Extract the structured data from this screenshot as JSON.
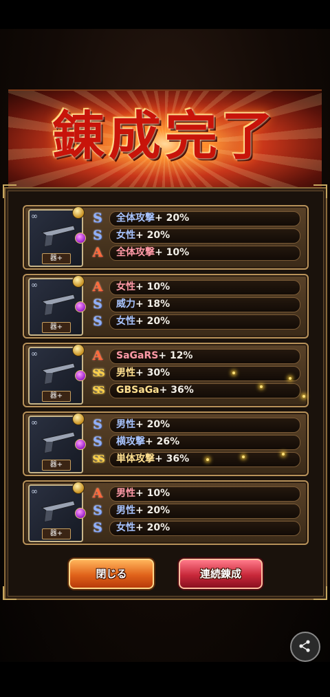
{
  "title": "錬成完了",
  "weapon_tag": "器+",
  "cards": [
    {
      "rows": [
        {
          "rank": "S",
          "name": "全体攻撃",
          "value": "+ 20%"
        },
        {
          "rank": "S",
          "name": "女性",
          "value": "+ 20%"
        },
        {
          "rank": "A",
          "name": "全体攻撃",
          "value": "+ 10%"
        }
      ]
    },
    {
      "rows": [
        {
          "rank": "A",
          "name": "女性",
          "value": "+ 10%"
        },
        {
          "rank": "S",
          "name": "威力",
          "value": "+ 18%"
        },
        {
          "rank": "S",
          "name": "女性",
          "value": "+ 20%"
        }
      ]
    },
    {
      "rows": [
        {
          "rank": "A",
          "name": "SaGaRS",
          "value": "+ 12%"
        },
        {
          "rank": "SS",
          "name": "男性",
          "value": "+ 30%"
        },
        {
          "rank": "SS",
          "name": "GBSaGa",
          "value": "+ 36%"
        }
      ]
    },
    {
      "rows": [
        {
          "rank": "S",
          "name": "男性",
          "value": "+ 20%"
        },
        {
          "rank": "S",
          "name": "横攻撃",
          "value": "+ 26%"
        },
        {
          "rank": "SS",
          "name": "単体攻撃",
          "value": "+ 36%"
        }
      ]
    },
    {
      "rows": [
        {
          "rank": "A",
          "name": "男性",
          "value": "+ 10%"
        },
        {
          "rank": "S",
          "name": "男性",
          "value": "+ 20%"
        },
        {
          "rank": "S",
          "name": "女性",
          "value": "+ 20%"
        }
      ]
    }
  ],
  "buttons": {
    "close": "閉じる",
    "continuous": "連続錬成"
  },
  "icons": {
    "share": "share-icon",
    "weapon": "pistol-icon",
    "gem": "gem-icon",
    "coin": "gold-coin-icon"
  },
  "colors": {
    "rank_S": "#8fb0ff",
    "rank_A": "#ff6a3a",
    "rank_SS": "#ffd24a",
    "close_button": "#e0621a",
    "continuous_button": "#c8283a"
  }
}
